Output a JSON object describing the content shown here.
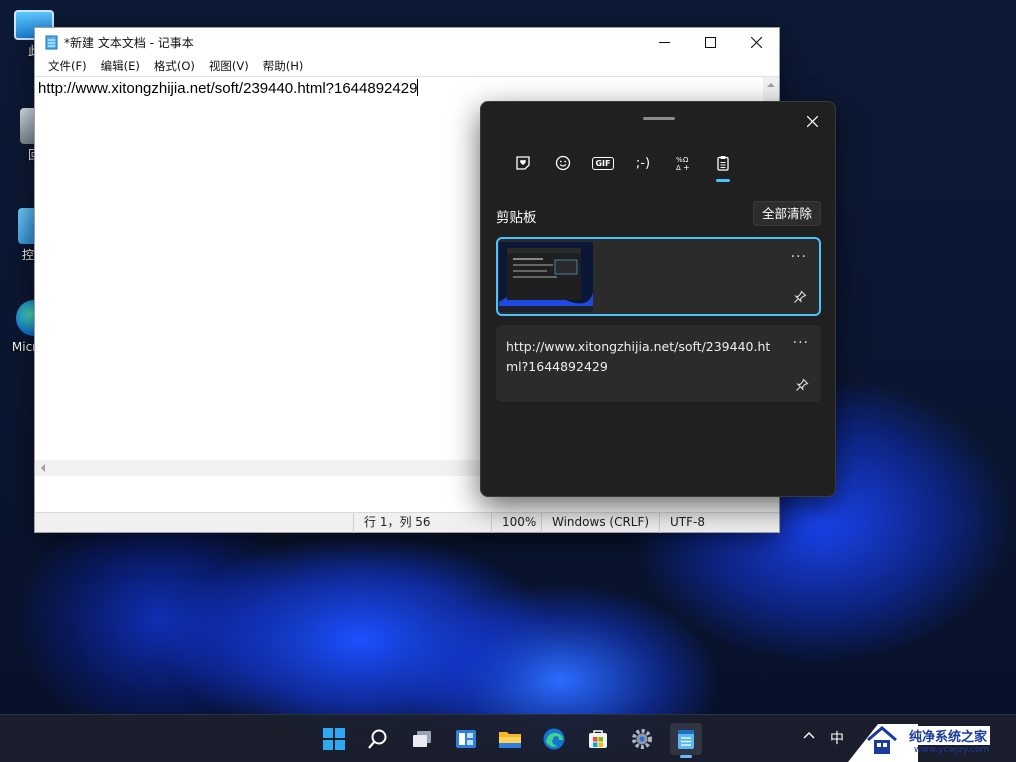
{
  "desktop": {
    "icons": [
      {
        "label": "此"
      },
      {
        "label": "回"
      },
      {
        "label": "控制"
      },
      {
        "label": "Micr Ed"
      }
    ]
  },
  "notepad": {
    "title": "*新建 文本文档 - 记事本",
    "menu": [
      "文件(F)",
      "编辑(E)",
      "格式(O)",
      "视图(V)",
      "帮助(H)"
    ],
    "content": "http://www.xitongzhijia.net/soft/239440.html?1644892429",
    "status": {
      "position": "行 1，列 56",
      "zoom": "100%",
      "line_ending": "Windows (CRLF)",
      "encoding": "UTF-8"
    }
  },
  "clipboard": {
    "tabs": [
      {
        "icon": "heart-sticker-icon"
      },
      {
        "icon": "emoji-icon"
      },
      {
        "icon": "gif-icon",
        "label": "GIF"
      },
      {
        "icon": "kaomoji-icon",
        "label": ";-)"
      },
      {
        "icon": "symbols-icon"
      },
      {
        "icon": "clipboard-icon",
        "active": true
      }
    ],
    "heading": "剪贴板",
    "clear_all": "全部清除",
    "items": [
      {
        "type": "image",
        "more": "···"
      },
      {
        "type": "text",
        "text": "http://www.xitongzhijia.net/soft/239440.html?1644892429",
        "more": "···"
      }
    ]
  },
  "taskbar": {
    "apps": [
      "start-icon",
      "search-icon",
      "task-view-icon",
      "widgets-icon",
      "file-explorer-icon",
      "edge-icon",
      "store-icon",
      "settings-icon",
      "notepad-icon"
    ],
    "tray": {
      "ime": "中"
    }
  },
  "watermark": {
    "line1": "纯净系统之家",
    "line2": "www.ycwjzy.com"
  },
  "colors": {
    "accent": "#4cc2ff",
    "panel_bg": "#202020",
    "card_bg": "#2b2b2b"
  }
}
